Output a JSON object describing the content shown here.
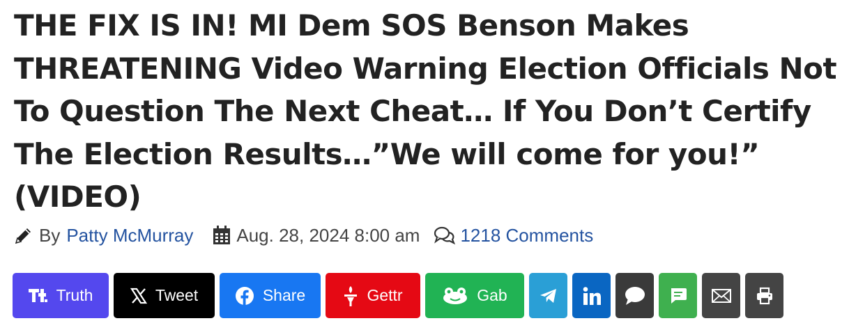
{
  "headline": "THE FIX IS IN! MI Dem SOS Benson Makes THREATENING Video Warning Election Officials Not To Question The Next Cheat… If You Don’t Certify The Election Results…”We will come for you!” (VIDEO)",
  "meta": {
    "by_label": "By",
    "author": "Patty McMurray",
    "date": "Aug. 28, 2024 8:00 am",
    "comments": "1218 Comments",
    "icons": [
      "pencil-icon",
      "calendar-icon",
      "comments-icon"
    ]
  },
  "share": {
    "truth": {
      "label": "Truth",
      "color": "#5448ee",
      "icon": "truth-social-icon"
    },
    "tweet": {
      "label": "Tweet",
      "color": "#000000",
      "icon": "x-icon"
    },
    "facebook": {
      "label": "Share",
      "color": "#1877f2",
      "icon": "facebook-icon"
    },
    "gettr": {
      "label": "Gettr",
      "color": "#e50914",
      "icon": "gettr-icon"
    },
    "gab": {
      "label": "Gab",
      "color": "#21b354",
      "icon": "gab-icon"
    },
    "telegram": {
      "color": "#2a9fd6",
      "icon": "telegram-icon"
    },
    "linkedin": {
      "color": "#0a66c2",
      "icon": "linkedin-icon"
    },
    "comment": {
      "color": "#3a3a3a",
      "icon": "speech-bubble-icon"
    },
    "sms": {
      "color": "#3fb04f",
      "icon": "sms-icon"
    },
    "email": {
      "color": "#444444",
      "icon": "mail-icon"
    },
    "print": {
      "color": "#444444",
      "icon": "print-icon"
    }
  }
}
